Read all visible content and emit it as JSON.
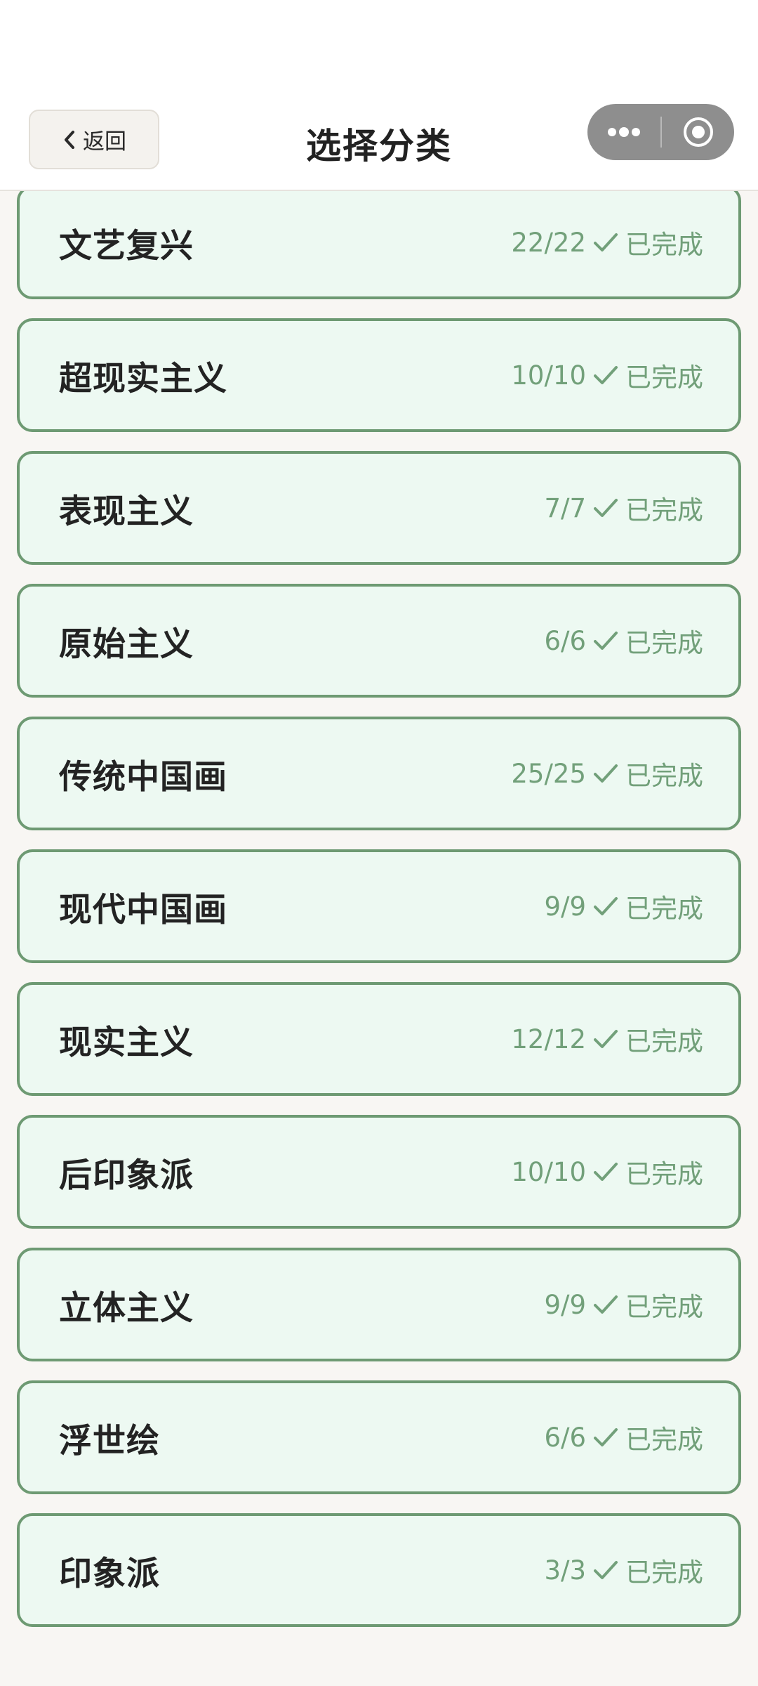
{
  "header": {
    "back_label": "返回",
    "title": "选择分类"
  },
  "status_label": "已完成",
  "colors": {
    "card_border": "#6e9a73",
    "card_background": "#edf9f2",
    "status_text": "#72a07a",
    "page_background": "#f8f6f3"
  },
  "categories": [
    {
      "name": "文艺复兴",
      "progress": "22/22"
    },
    {
      "name": "超现实主义",
      "progress": "10/10"
    },
    {
      "name": "表现主义",
      "progress": "7/7"
    },
    {
      "name": "原始主义",
      "progress": "6/6"
    },
    {
      "name": "传统中国画",
      "progress": "25/25"
    },
    {
      "name": "现代中国画",
      "progress": "9/9"
    },
    {
      "name": "现实主义",
      "progress": "12/12"
    },
    {
      "name": "后印象派",
      "progress": "10/10"
    },
    {
      "name": "立体主义",
      "progress": "9/9"
    },
    {
      "name": "浮世绘",
      "progress": "6/6"
    },
    {
      "name": "印象派",
      "progress": "3/3"
    }
  ]
}
